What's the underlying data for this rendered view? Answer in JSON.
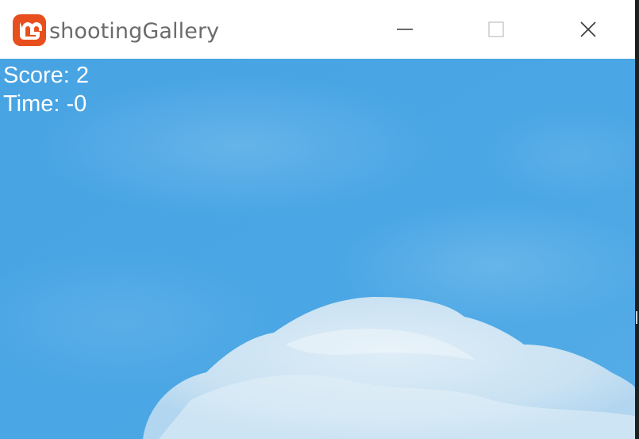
{
  "window": {
    "title": "shootingGallery",
    "icon": "monogame-logo-icon",
    "controls": {
      "minimize_icon": "minimize-icon",
      "maximize_icon": "maximize-icon",
      "close_icon": "close-icon"
    }
  },
  "hud": {
    "score_text": "Score: 2",
    "time_text": "Time: -0"
  },
  "colors": {
    "logo": "#e7501e",
    "sky": "#4aa3e2",
    "cloud": "#dcecf6",
    "hud_text": "#ffffff",
    "title_text": "#6b6b6b"
  }
}
